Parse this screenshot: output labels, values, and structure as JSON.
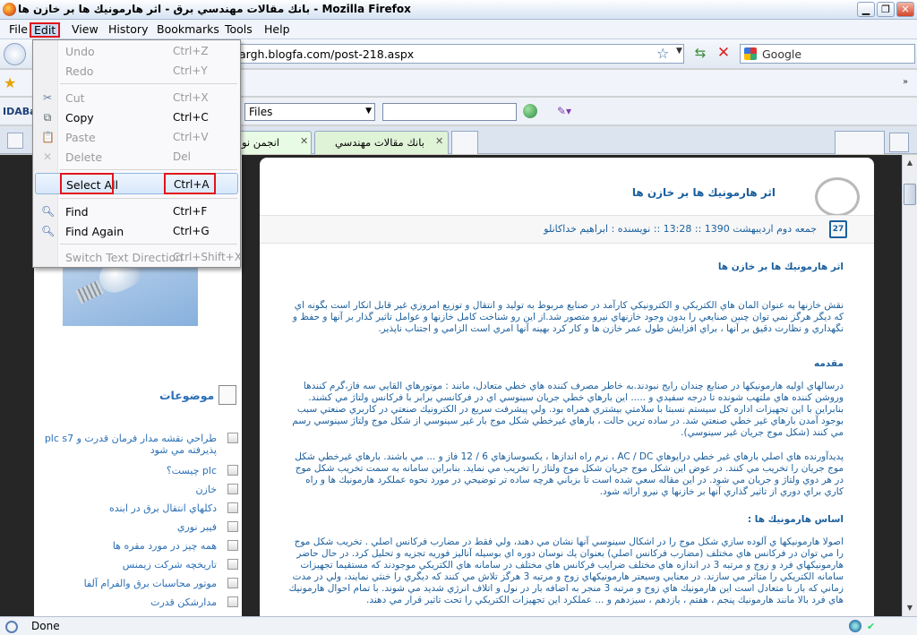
{
  "window": {
    "title": "بانك مقالات مهندسي برق - اثر هارمونيك ها بر خازن ها - Mozilla Firefox",
    "minimize": "▁",
    "restore": "❐",
    "close": "✕"
  },
  "menubar": [
    "File",
    "Edit",
    "View",
    "History",
    "Bookmarks",
    "Tools",
    "Help"
  ],
  "navbar": {
    "url": "argh.blogfa.com/post-218.aspx",
    "search_placeholder": "Google"
  },
  "ida_toolbar": {
    "logo": "IDABar",
    "files_label": "Files"
  },
  "tabs": [
    {
      "label": "...انجمن نو",
      "close": "✕"
    },
    {
      "label": "بانك مقالات مهندسي",
      "close": "✕"
    }
  ],
  "edit_menu": [
    {
      "label": "Undo",
      "shortcut": "Ctrl+Z",
      "enabled": false
    },
    {
      "label": "Redo",
      "shortcut": "Ctrl+Y",
      "enabled": false
    },
    {
      "label": "Cut",
      "shortcut": "Ctrl+X",
      "enabled": false
    },
    {
      "label": "Copy",
      "shortcut": "Ctrl+C",
      "enabled": true
    },
    {
      "label": "Paste",
      "shortcut": "Ctrl+V",
      "enabled": false
    },
    {
      "label": "Delete",
      "shortcut": "Del",
      "enabled": false
    },
    {
      "label": "Select All",
      "shortcut": "Ctrl+A",
      "enabled": true,
      "highlighted": true
    },
    {
      "label": "Find",
      "shortcut": "Ctrl+F",
      "enabled": true
    },
    {
      "label": "Find Again",
      "shortcut": "Ctrl+G",
      "enabled": true
    },
    {
      "label": "Switch Text Direction",
      "shortcut": "Ctrl+Shift+X",
      "enabled": false
    }
  ],
  "sidebar": {
    "heading": "موضوعات",
    "items": [
      "طراحي نقشه مدار فرمان قدرت و plc s7 پذيرفته مي شود",
      "plc چيست؟",
      "خازن",
      "دكلهاي انتقال برق در ابنده",
      "فيبر نوري",
      "همه چيز در مورد مقره ها",
      "تاريخچه شركت زيمنس",
      "موتور محاسبات برق والفرام آلفا",
      "مدارشكن قدرت"
    ]
  },
  "post": {
    "title": "اثر هارمونيك ها بر خازن ها",
    "meta": "جمعه دوم ارديبهشت 1390 :: 13:28 ::  نويسنده : ابراهيم خداكانلو",
    "calendar_day": "27",
    "heading1": "اثر هارمونيك ها بر خازن ها",
    "p1": "نقش خازنها به عنوان المان هاي الكتريكي و الكترونيكي كارآمد در صنايع مربوط به توليد و انتقال و توزيع امروزي غير قابل انكار است بگونه اي كه ديگر هرگز نمي توان چنين صنايعي را بدون وجود خازنهاي نيرو متصور شد.از اين رو شناخت كامل خازنها و عوامل تاثير گذار بر آنها و حفظ و نگهداري و نظارت دقيق بر آنها ، براي افزايش طول عمر خازن ها و كار كرد بهينه آنها امري است الزامي و اجتناب ناپذير.",
    "heading2": "مقدمه",
    "p2": "درسالهاي اوليه هارمونيكها در صنايع چندان رايج نبودند.به خاطر مصرف كننده هاي خطي متعادل، مانند : موتورهاي القايي سه فاز،گرم كنندها وروشن كننده هاي ملتهب شونده تا درجه سفيدي و ..... اين بارهاي خطي جريان سينوسي اي در فركانسي برابر با فركانس ولتاژ مي كشند. بنابراين با اين تجهيزات اداره كل سيستم نسبتا با سلامتي بيشتري همراه بود. ولي پيشرفت سريع در الكترونيك صنعتي در كاربري صنعتي سبب بوجود آمدن بارهاي غير خطي صنعتي شد. در ساده ترين حالت ، بارهاي غيرخطي شكل موج بار غير سينوسي از شكل موج ولتاژ سينوسي رسم مي كنند (شكل موج جريان غير سينوسي).",
    "p3": "پديدآورنده هاي اصلي بارهاي غير خطي درايوهاي AC / DC ، نرم راه اندازها ، يكسوسازهاي 6 / 12 فاز و ... مي باشند. بارهاي غيرخطي شكل موج جريان را تخريب مي كنند. در عوض اين شكل موج جريان شكل موج ولتاژ را تخريب مي نمايد. بنابراين سامانه به سمت تخريب شكل موج در هر دوي ولتاژ و جريان مي شود. در اين مقاله سعي شده است تا بزباني هرچه ساده تر توضيحي در مورد نحوه عملكرد هارمونيك ها و راه كاري براي دوري از تاثير گذاري آنها بر خازنها ي نيرو ارائه شود.",
    "heading3": "اساس هارمونيك ها :",
    "p4": "اصولا هارمونيكها ي آلوده سازي شكل موج را در اشكال سينوسي آنها نشان مي دهند، ولي فقط در مضارب فركانس اصلي . تخريب شكل موج را مي توان در فركانس هاي مختلف (مضارب فركانس اصلي) بعنوان يك نوسان دوره اي بوسيله آناليز فوريه تجزيه و تحليل كرد. در حال حاضر هارمونيكهاي فرد و زوج و مرتبه 3 در اندازه هاي مختلف ضرايب فركانس هاي مختلف در سامانه هاي الكتريكي موجودند كه مستقيما تجهيزات سامانه الكتريكي را متاثر مي سازند. در معنايي وسيعتر هارمونيكهاي زوج و مرتبه 3 هرگز تلاش مي كنند كه ديگري را خنثي نمايند، ولي در مدت زماني كه بار نا متعادل است اين هارمونيك هاي زوج و مرتبه 3 منجر به اضافه بار در نول و اتلاف انرژي شديد مي شوند. با تمام احوال هارمونيك هاي فرد بالا مانند هارمونيك پنجم ، هفتم ، يازدهم ، سيزدهم و ... عملكرد اين تجهيزات الكتريكي را تحت تاثير قرار مي دهند."
  },
  "status": {
    "text": "Done"
  }
}
